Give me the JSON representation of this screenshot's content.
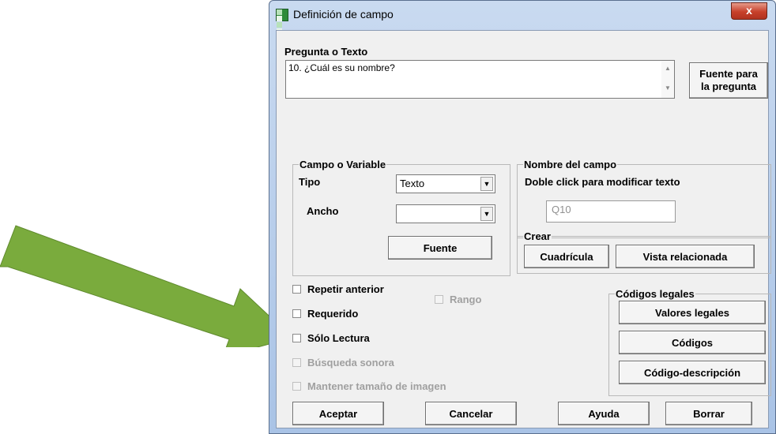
{
  "window": {
    "title": "Definición de campo",
    "close_glyph": "x"
  },
  "question": {
    "label": "Pregunta o Texto",
    "text": "10. ¿Cuál es su nombre?",
    "font_button": "Fuente para la pregunta"
  },
  "campo_variable": {
    "title": "Campo o Variable",
    "tipo_label": "Tipo",
    "tipo_value": "Texto",
    "ancho_label": "Ancho",
    "ancho_value": "",
    "fuente_button": "Fuente"
  },
  "nombre_campo": {
    "title": "Nombre del campo",
    "hint": "Doble click para modificar texto",
    "value": "Q10"
  },
  "crear": {
    "title": "Crear",
    "cuadricula_button": "Cuadrícula",
    "vista_button": "Vista relacionada"
  },
  "options": {
    "repetir": "Repetir anterior",
    "requerido": "Requerido",
    "solo_lectura": "Sólo Lectura",
    "busqueda": "Búsqueda sonora",
    "mantener": "Mantener tamaño de imagen",
    "rango": "Rango"
  },
  "codigos": {
    "title": "Códigos legales",
    "valores_button": "Valores legales",
    "codigos_button": "Códigos",
    "codigo_desc_button": "Código-descripción"
  },
  "footer": {
    "aceptar": "Aceptar",
    "cancelar": "Cancelar",
    "ayuda": "Ayuda",
    "borrar": "Borrar"
  },
  "colors": {
    "arrow": "#7aab3d",
    "close": "#c7402b",
    "titlebar": "#a9c3e6"
  }
}
